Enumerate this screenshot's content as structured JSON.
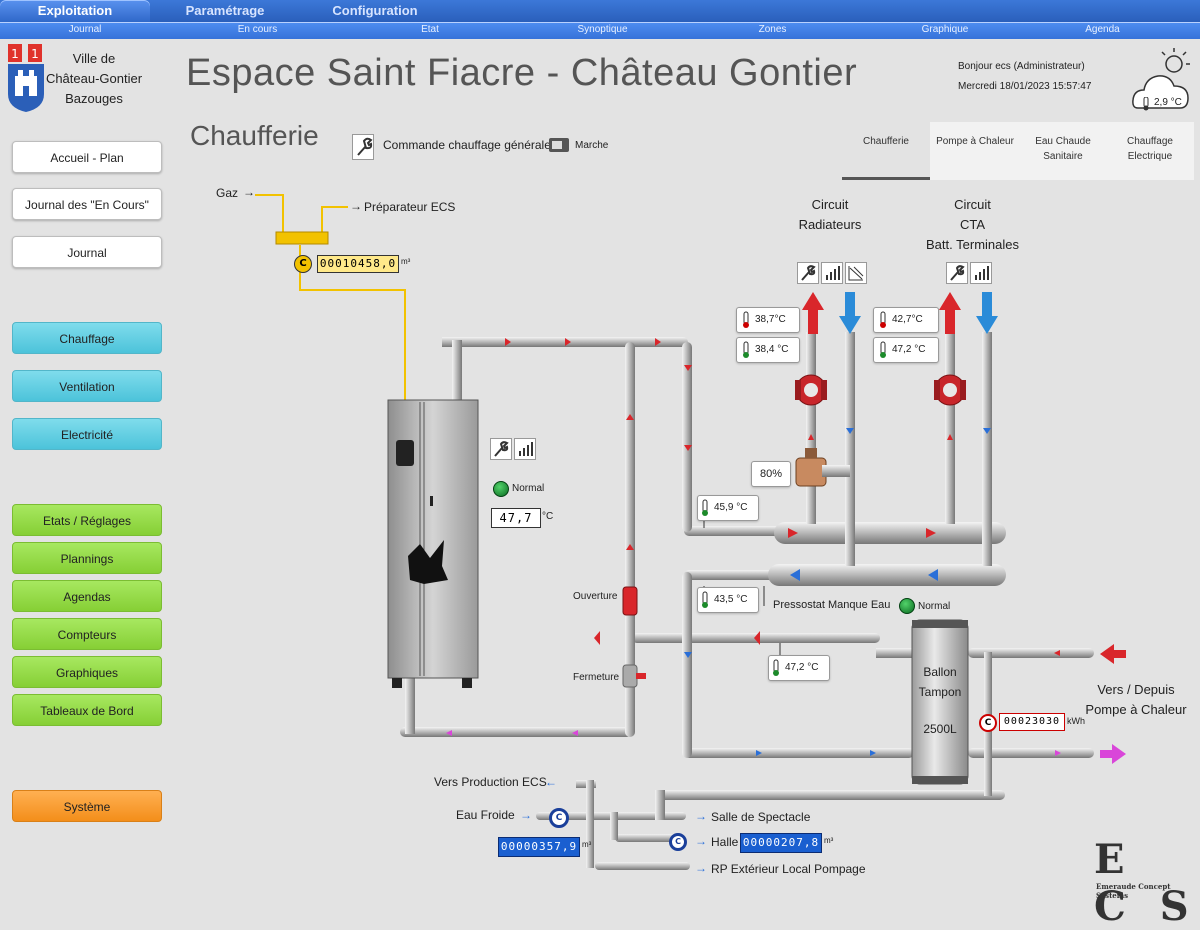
{
  "nav": {
    "tabs": [
      "Exploitation",
      "Paramétrage",
      "Configuration"
    ],
    "subtabs": [
      "Journal",
      "En cours",
      "Etat",
      "Synoptique",
      "Zones",
      "Graphique",
      "Agenda"
    ]
  },
  "logo": {
    "line1": "Ville de",
    "line2": "Château-Gontier",
    "line3": "Bazouges"
  },
  "sidebar": {
    "top": [
      "Accueil - Plan",
      "Journal des \"En Cours\"",
      "Journal"
    ],
    "domains": [
      "Chauffage",
      "Ventilation",
      "Electricité"
    ],
    "tools": [
      "Etats / Réglages",
      "Plannings",
      "Agendas",
      "Compteurs",
      "Graphiques",
      "Tableaux de Bord"
    ],
    "system": "Système"
  },
  "header": {
    "title": "Espace Saint Fiacre - Château Gontier",
    "greeting": "Bonjour ecs (Administrateur)",
    "datetime": "Mercredi 18/01/2023 15:57:47",
    "weather_temp": "2,9 °C"
  },
  "page": {
    "section": "Chaufferie",
    "command_label": "Commande chauffage générale",
    "command_state": "Marche",
    "subtabs": [
      "Chaufferie",
      "Pompe à Chaleur",
      "Eau Chaude Sanitaire",
      "Chauffage Electrique"
    ]
  },
  "synoptic": {
    "gaz": "Gaz",
    "preparateur": "Préparateur ECS",
    "gas_meter": "00010458,0",
    "gas_unit": "m³",
    "boiler_status": "Normal",
    "boiler_temp": "47,7",
    "boiler_unit": "°C",
    "circuit_radiateurs": [
      "Circuit",
      "Radiateurs"
    ],
    "circuit_cta": [
      "Circuit",
      "CTA",
      "Batt. Terminales"
    ],
    "rad_depart_temp": "38,7°C",
    "rad_retour_temp": "38,4 °C",
    "cta_depart_temp": "42,7°C",
    "cta_retour_temp": "47,2 °C",
    "valve_pct": "80%",
    "collector_hot_temp": "45,9 °C",
    "collector_cold_temp": "43,5 °C",
    "pressostat_label": "Pressostat Manque Eau",
    "pressostat_status": "Normal",
    "ouverture": "Ouverture",
    "fermeture": "Fermeture",
    "tampon_temp": "47,2 °C",
    "ballon": [
      "Ballon",
      "Tampon",
      "2500L"
    ],
    "heat_meter": "00023030",
    "heat_unit": "kWh",
    "pac_label": [
      "Vers / Depuis",
      "Pompe à Chaleur"
    ],
    "vers_ecs": "Vers Production ECS",
    "eau_froide": "Eau Froide",
    "cold_meter": "00000357,9",
    "cold_unit": "m³",
    "salle": "Salle de Spectacle",
    "halle": "Halle",
    "halle_meter": "00000207,8",
    "halle_unit": "m³",
    "rp": "RP Extérieur Local Pompage"
  },
  "brand": {
    "letters": "E C S",
    "tagline": "Emeraude Concept Systems"
  },
  "colors": {
    "pipe": "#b5b5b5",
    "gas": "#f2c200",
    "hot": "#d9262b",
    "cold": "#2a6fd8",
    "pac": "#d946d9"
  }
}
